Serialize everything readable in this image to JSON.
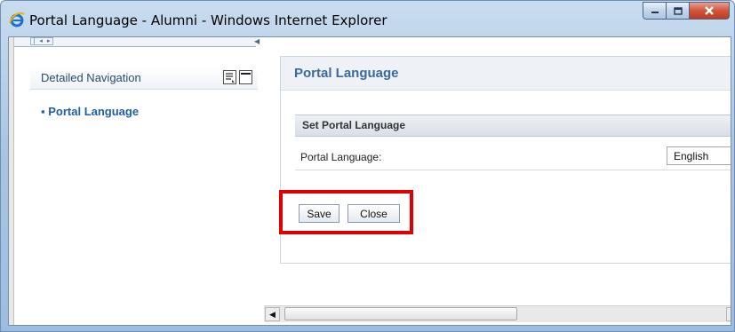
{
  "window": {
    "title": "Portal Language - Alumni - Windows Internet Explorer",
    "controls": {
      "minimize": "minimize",
      "maximize": "maximize",
      "close": "close"
    }
  },
  "nav": {
    "header": "Detailed Navigation",
    "items": [
      {
        "label": "Portal Language"
      }
    ]
  },
  "content": {
    "title": "Portal Language",
    "group_title": "Set Portal Language",
    "field_label": "Portal Language:",
    "field_value": "English",
    "save_label": "Save",
    "close_label": "Close"
  },
  "colors": {
    "highlight": "#e00000",
    "nav_item": "#1f5fa8",
    "content_title": "#3a6a9e"
  },
  "icons": [
    "ie-logo-icon",
    "minimize-icon",
    "maximize-icon",
    "close-icon",
    "scroll-left-icon",
    "scroll-right-icon",
    "personalize-icon",
    "collapse-icon"
  ]
}
